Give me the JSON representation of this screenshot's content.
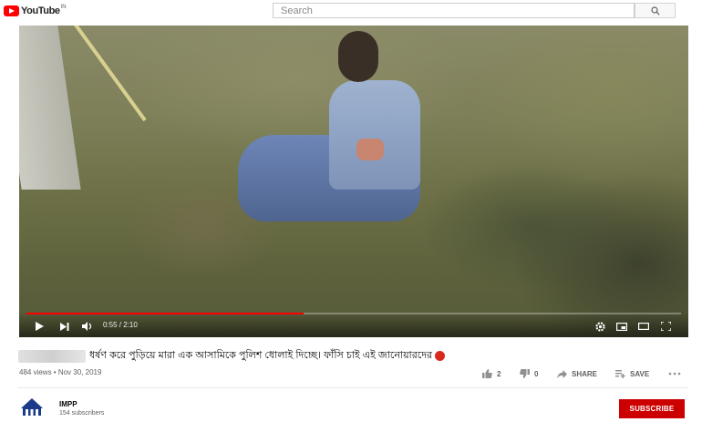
{
  "header": {
    "brand": "YouTube",
    "country_code": "IN",
    "search_placeholder": "Search"
  },
  "player": {
    "time": "0:55 / 2:10",
    "progress_fraction": 0.423
  },
  "video": {
    "title": "ধর্ষণ করে পুড়িয়ে মারা এক আসামিকে পুলিশ ধোলাই দিচ্ছে। ফাঁসি চাই এই জানোয়ারদের",
    "views_date": "484 views • Nov 30, 2019",
    "likes": "2",
    "dislikes": "0",
    "share_label": "SHARE",
    "save_label": "SAVE"
  },
  "channel": {
    "name": "IMPP",
    "subscribers": "154 subscribers",
    "subscribe_label": "SUBSCRIBE"
  },
  "colors": {
    "accent": "#ff0000",
    "subscribe": "#cc0000"
  }
}
